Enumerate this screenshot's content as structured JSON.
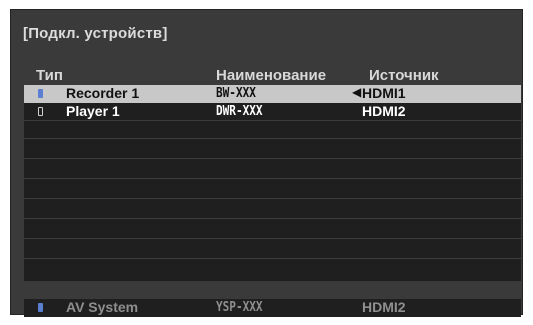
{
  "dialog": {
    "title": "[Подкл. устройств]",
    "columns": {
      "type": "Тип",
      "name": "Наименование",
      "source": "Источник"
    }
  },
  "devices": [
    {
      "icon": "recorder-icon",
      "name": "Recorder 1",
      "model": "BW-XXX",
      "source": "HDMI1",
      "selected": true,
      "arrow": "◀"
    },
    {
      "icon": "player-icon",
      "name": "Player 1",
      "model": "DWR-XXX",
      "source": "HDMI2",
      "selected": false,
      "arrow": ""
    }
  ],
  "av_system": {
    "icon": "av-system-icon",
    "name": "AV System",
    "model": "YSP-XXX",
    "source": "HDMI2"
  },
  "colors": {
    "background": "#3a3a3a",
    "list": "#1f1f1f",
    "selected": "#c8c8c8",
    "icon_blue": "#5a7fd0"
  }
}
